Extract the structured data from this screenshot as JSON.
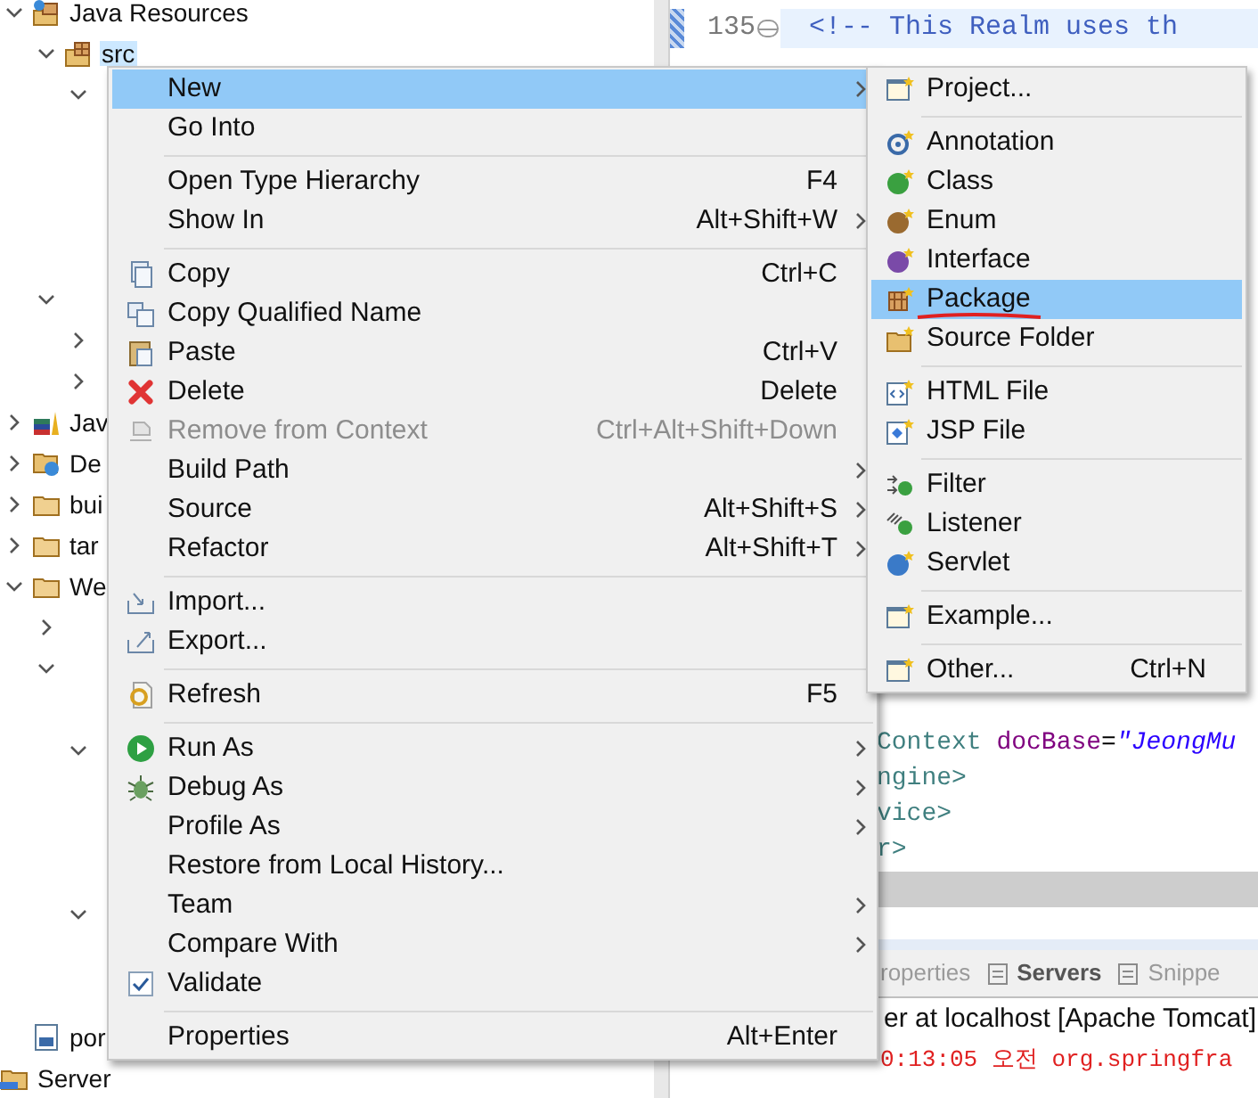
{
  "tree": [
    {
      "label": "Java Resources",
      "expanded": true,
      "children": [
        {
          "label": "src",
          "expanded": true,
          "selected": true,
          "children": [
            {
              "expanded": true
            }
          ]
        },
        {
          "expanded": true,
          "children": [
            {
              "expanded": false
            },
            {
              "expanded": false
            }
          ]
        }
      ]
    },
    {
      "label": "Jav",
      "expanded": false
    },
    {
      "label": "De",
      "expanded": false
    },
    {
      "label": "bui",
      "expanded": false
    },
    {
      "label": "tar",
      "expanded": false
    },
    {
      "label": "We",
      "expanded": true,
      "children": [
        {
          "expanded": false
        },
        {
          "expanded": true,
          "children": [
            {
              "expanded": true
            },
            {
              "expanded": true
            }
          ]
        }
      ]
    },
    {
      "label": "por"
    },
    {
      "label": "Server",
      "kind": "root"
    }
  ],
  "editor": {
    "current_line": {
      "number": "135",
      "text": "<!-- This Realm uses th"
    },
    "lines": [
      [
        {
          "kind": "tag",
          "text": "Context"
        },
        {
          "kind": "attr",
          "text": " docBase"
        },
        {
          "kind": "plain",
          "text": "="
        },
        {
          "kind": "string",
          "text": "\"JeongMu"
        }
      ],
      [
        {
          "kind": "tag",
          "text": "ngine>"
        }
      ],
      [
        {
          "kind": "tag",
          "text": "vice>"
        }
      ],
      [
        {
          "kind": "tag",
          "text": "r>"
        }
      ]
    ]
  },
  "views": {
    "tabs": [
      {
        "label": "roperties",
        "selected": false
      },
      {
        "label": "Servers",
        "selected": true
      },
      {
        "label": "Snippe",
        "selected": false
      }
    ],
    "console_title": "er at localhost [Apache Tomcat]",
    "console_line": "0:13:05 오전 org.springfra"
  },
  "context_menu": [
    {
      "kind": "item",
      "label": "New",
      "submenu": true,
      "selected": true
    },
    {
      "kind": "item",
      "label": "Go Into"
    },
    {
      "kind": "separator"
    },
    {
      "kind": "item",
      "label": "Open Type Hierarchy",
      "shortcut": "F4"
    },
    {
      "kind": "item",
      "label": "Show In",
      "shortcut": "Alt+Shift+W",
      "submenu": true
    },
    {
      "kind": "separator"
    },
    {
      "kind": "item",
      "label": "Copy",
      "shortcut": "Ctrl+C"
    },
    {
      "kind": "item",
      "label": "Copy Qualified Name"
    },
    {
      "kind": "item",
      "label": "Paste",
      "shortcut": "Ctrl+V"
    },
    {
      "kind": "item",
      "label": "Delete",
      "shortcut": "Delete"
    },
    {
      "kind": "item",
      "label": "Remove from Context",
      "shortcut": "Ctrl+Alt+Shift+Down",
      "disabled": true
    },
    {
      "kind": "item",
      "label": "Build Path",
      "submenu": true
    },
    {
      "kind": "item",
      "label": "Source",
      "shortcut": "Alt+Shift+S",
      "submenu": true
    },
    {
      "kind": "item",
      "label": "Refactor",
      "shortcut": "Alt+Shift+T",
      "submenu": true
    },
    {
      "kind": "separator"
    },
    {
      "kind": "item",
      "label": "Import..."
    },
    {
      "kind": "item",
      "label": "Export..."
    },
    {
      "kind": "separator"
    },
    {
      "kind": "item",
      "label": "Refresh",
      "shortcut": "F5"
    },
    {
      "kind": "separator"
    },
    {
      "kind": "item",
      "label": "Run As",
      "submenu": true
    },
    {
      "kind": "item",
      "label": "Debug As",
      "submenu": true
    },
    {
      "kind": "item",
      "label": "Profile As",
      "submenu": true
    },
    {
      "kind": "item",
      "label": "Restore from Local History..."
    },
    {
      "kind": "item",
      "label": "Team",
      "submenu": true
    },
    {
      "kind": "item",
      "label": "Compare With",
      "submenu": true
    },
    {
      "kind": "item",
      "label": "Validate"
    },
    {
      "kind": "separator"
    },
    {
      "kind": "item",
      "label": "Properties",
      "shortcut": "Alt+Enter"
    }
  ],
  "new_submenu": [
    {
      "kind": "item",
      "label": "Project..."
    },
    {
      "kind": "separator"
    },
    {
      "kind": "item",
      "label": "Annotation"
    },
    {
      "kind": "item",
      "label": "Class"
    },
    {
      "kind": "item",
      "label": "Enum"
    },
    {
      "kind": "item",
      "label": "Interface"
    },
    {
      "kind": "item",
      "label": "Package",
      "selected": true,
      "underlined": true
    },
    {
      "kind": "item",
      "label": "Source Folder"
    },
    {
      "kind": "separator"
    },
    {
      "kind": "item",
      "label": "HTML File"
    },
    {
      "kind": "item",
      "label": "JSP File"
    },
    {
      "kind": "separator"
    },
    {
      "kind": "item",
      "label": "Filter"
    },
    {
      "kind": "item",
      "label": "Listener"
    },
    {
      "kind": "item",
      "label": "Servlet"
    },
    {
      "kind": "separator"
    },
    {
      "kind": "item",
      "label": "Example..."
    },
    {
      "kind": "separator"
    },
    {
      "kind": "item",
      "label": "Other...",
      "shortcut": "Ctrl+N"
    }
  ]
}
